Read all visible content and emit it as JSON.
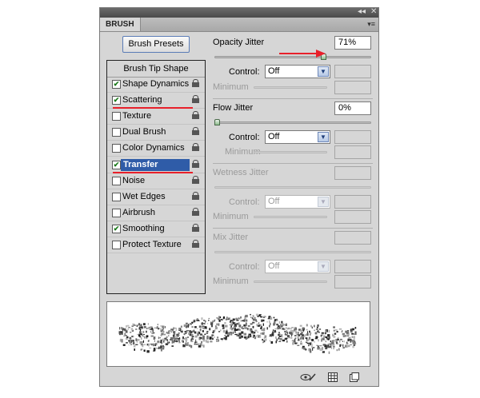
{
  "panel": {
    "tab_label": "BRUSH",
    "collapse_glyph": "◂◂",
    "close_glyph": "✕",
    "menu_glyph": "▾≡"
  },
  "presets_button": "Brush Presets",
  "sidebar": {
    "header": "Brush Tip Shape",
    "items": [
      {
        "label": "Shape Dynamics",
        "checked": true
      },
      {
        "label": "Scattering",
        "checked": true
      },
      {
        "label": "Texture",
        "checked": false
      },
      {
        "label": "Dual Brush",
        "checked": false
      },
      {
        "label": "Color Dynamics",
        "checked": false
      },
      {
        "label": "Transfer",
        "checked": true,
        "selected": true
      },
      {
        "label": "Noise",
        "checked": false
      },
      {
        "label": "Wet Edges",
        "checked": false
      },
      {
        "label": "Airbrush",
        "checked": false
      },
      {
        "label": "Smoothing",
        "checked": true
      },
      {
        "label": "Protect Texture",
        "checked": false
      }
    ]
  },
  "opacity": {
    "label": "Opacity Jitter",
    "value": "71%",
    "level": 0.71,
    "control_label": "Control:",
    "control_value": "Off",
    "minimum_label": "Minimum"
  },
  "flow": {
    "label": "Flow Jitter",
    "value": "0%",
    "level": 0,
    "control_label": "Control:",
    "control_value": "Off",
    "minimum_label": "Minimum"
  },
  "wetness": {
    "label": "Wetness Jitter",
    "control_label": "Control:",
    "control_value": "Off",
    "minimum_label": "Minimum"
  },
  "mix": {
    "label": "Mix Jitter",
    "control_label": "Control:",
    "control_value": "Off",
    "minimum_label": "Minimum"
  },
  "checkmark": "✔",
  "select_arrow": "▼",
  "icons": {
    "bottom": [
      "eye-brush-icon",
      "grid-panel-icon",
      "new-brush-icon"
    ]
  },
  "colors": {
    "accent_red": "#e8202a",
    "selection_blue": "#2f5ca8"
  }
}
